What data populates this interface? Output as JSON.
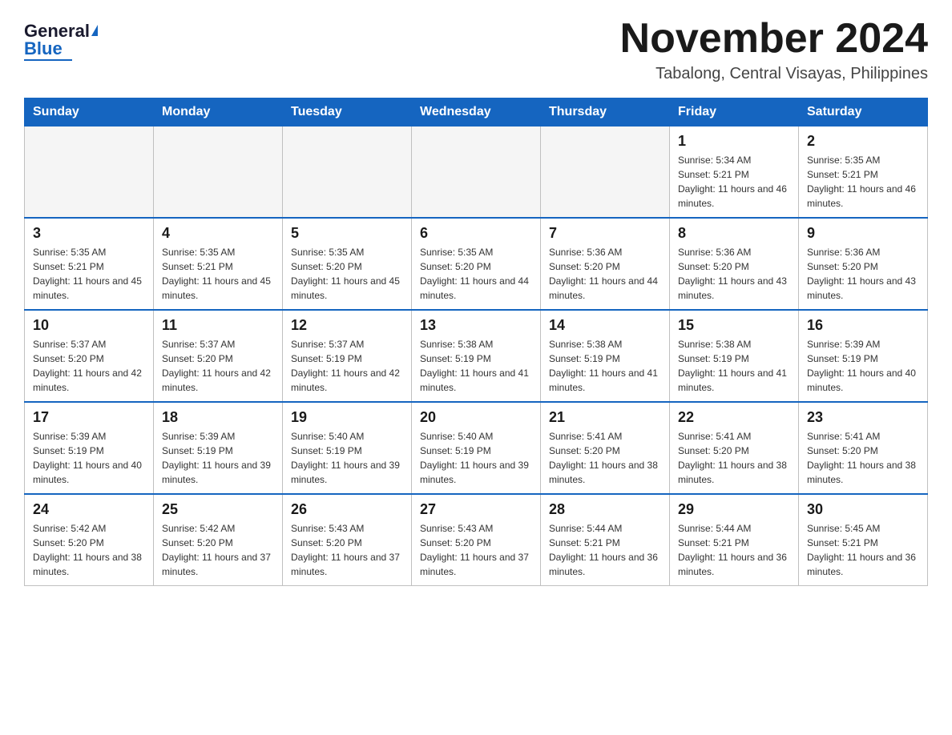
{
  "header": {
    "logo_general": "General",
    "logo_blue": "Blue",
    "month_title": "November 2024",
    "location": "Tabalong, Central Visayas, Philippines"
  },
  "weekdays": [
    "Sunday",
    "Monday",
    "Tuesday",
    "Wednesday",
    "Thursday",
    "Friday",
    "Saturday"
  ],
  "weeks": [
    [
      {
        "day": "",
        "sunrise": "",
        "sunset": "",
        "daylight": ""
      },
      {
        "day": "",
        "sunrise": "",
        "sunset": "",
        "daylight": ""
      },
      {
        "day": "",
        "sunrise": "",
        "sunset": "",
        "daylight": ""
      },
      {
        "day": "",
        "sunrise": "",
        "sunset": "",
        "daylight": ""
      },
      {
        "day": "",
        "sunrise": "",
        "sunset": "",
        "daylight": ""
      },
      {
        "day": "1",
        "sunrise": "Sunrise: 5:34 AM",
        "sunset": "Sunset: 5:21 PM",
        "daylight": "Daylight: 11 hours and 46 minutes."
      },
      {
        "day": "2",
        "sunrise": "Sunrise: 5:35 AM",
        "sunset": "Sunset: 5:21 PM",
        "daylight": "Daylight: 11 hours and 46 minutes."
      }
    ],
    [
      {
        "day": "3",
        "sunrise": "Sunrise: 5:35 AM",
        "sunset": "Sunset: 5:21 PM",
        "daylight": "Daylight: 11 hours and 45 minutes."
      },
      {
        "day": "4",
        "sunrise": "Sunrise: 5:35 AM",
        "sunset": "Sunset: 5:21 PM",
        "daylight": "Daylight: 11 hours and 45 minutes."
      },
      {
        "day": "5",
        "sunrise": "Sunrise: 5:35 AM",
        "sunset": "Sunset: 5:20 PM",
        "daylight": "Daylight: 11 hours and 45 minutes."
      },
      {
        "day": "6",
        "sunrise": "Sunrise: 5:35 AM",
        "sunset": "Sunset: 5:20 PM",
        "daylight": "Daylight: 11 hours and 44 minutes."
      },
      {
        "day": "7",
        "sunrise": "Sunrise: 5:36 AM",
        "sunset": "Sunset: 5:20 PM",
        "daylight": "Daylight: 11 hours and 44 minutes."
      },
      {
        "day": "8",
        "sunrise": "Sunrise: 5:36 AM",
        "sunset": "Sunset: 5:20 PM",
        "daylight": "Daylight: 11 hours and 43 minutes."
      },
      {
        "day": "9",
        "sunrise": "Sunrise: 5:36 AM",
        "sunset": "Sunset: 5:20 PM",
        "daylight": "Daylight: 11 hours and 43 minutes."
      }
    ],
    [
      {
        "day": "10",
        "sunrise": "Sunrise: 5:37 AM",
        "sunset": "Sunset: 5:20 PM",
        "daylight": "Daylight: 11 hours and 42 minutes."
      },
      {
        "day": "11",
        "sunrise": "Sunrise: 5:37 AM",
        "sunset": "Sunset: 5:20 PM",
        "daylight": "Daylight: 11 hours and 42 minutes."
      },
      {
        "day": "12",
        "sunrise": "Sunrise: 5:37 AM",
        "sunset": "Sunset: 5:19 PM",
        "daylight": "Daylight: 11 hours and 42 minutes."
      },
      {
        "day": "13",
        "sunrise": "Sunrise: 5:38 AM",
        "sunset": "Sunset: 5:19 PM",
        "daylight": "Daylight: 11 hours and 41 minutes."
      },
      {
        "day": "14",
        "sunrise": "Sunrise: 5:38 AM",
        "sunset": "Sunset: 5:19 PM",
        "daylight": "Daylight: 11 hours and 41 minutes."
      },
      {
        "day": "15",
        "sunrise": "Sunrise: 5:38 AM",
        "sunset": "Sunset: 5:19 PM",
        "daylight": "Daylight: 11 hours and 41 minutes."
      },
      {
        "day": "16",
        "sunrise": "Sunrise: 5:39 AM",
        "sunset": "Sunset: 5:19 PM",
        "daylight": "Daylight: 11 hours and 40 minutes."
      }
    ],
    [
      {
        "day": "17",
        "sunrise": "Sunrise: 5:39 AM",
        "sunset": "Sunset: 5:19 PM",
        "daylight": "Daylight: 11 hours and 40 minutes."
      },
      {
        "day": "18",
        "sunrise": "Sunrise: 5:39 AM",
        "sunset": "Sunset: 5:19 PM",
        "daylight": "Daylight: 11 hours and 39 minutes."
      },
      {
        "day": "19",
        "sunrise": "Sunrise: 5:40 AM",
        "sunset": "Sunset: 5:19 PM",
        "daylight": "Daylight: 11 hours and 39 minutes."
      },
      {
        "day": "20",
        "sunrise": "Sunrise: 5:40 AM",
        "sunset": "Sunset: 5:19 PM",
        "daylight": "Daylight: 11 hours and 39 minutes."
      },
      {
        "day": "21",
        "sunrise": "Sunrise: 5:41 AM",
        "sunset": "Sunset: 5:20 PM",
        "daylight": "Daylight: 11 hours and 38 minutes."
      },
      {
        "day": "22",
        "sunrise": "Sunrise: 5:41 AM",
        "sunset": "Sunset: 5:20 PM",
        "daylight": "Daylight: 11 hours and 38 minutes."
      },
      {
        "day": "23",
        "sunrise": "Sunrise: 5:41 AM",
        "sunset": "Sunset: 5:20 PM",
        "daylight": "Daylight: 11 hours and 38 minutes."
      }
    ],
    [
      {
        "day": "24",
        "sunrise": "Sunrise: 5:42 AM",
        "sunset": "Sunset: 5:20 PM",
        "daylight": "Daylight: 11 hours and 38 minutes."
      },
      {
        "day": "25",
        "sunrise": "Sunrise: 5:42 AM",
        "sunset": "Sunset: 5:20 PM",
        "daylight": "Daylight: 11 hours and 37 minutes."
      },
      {
        "day": "26",
        "sunrise": "Sunrise: 5:43 AM",
        "sunset": "Sunset: 5:20 PM",
        "daylight": "Daylight: 11 hours and 37 minutes."
      },
      {
        "day": "27",
        "sunrise": "Sunrise: 5:43 AM",
        "sunset": "Sunset: 5:20 PM",
        "daylight": "Daylight: 11 hours and 37 minutes."
      },
      {
        "day": "28",
        "sunrise": "Sunrise: 5:44 AM",
        "sunset": "Sunset: 5:21 PM",
        "daylight": "Daylight: 11 hours and 36 minutes."
      },
      {
        "day": "29",
        "sunrise": "Sunrise: 5:44 AM",
        "sunset": "Sunset: 5:21 PM",
        "daylight": "Daylight: 11 hours and 36 minutes."
      },
      {
        "day": "30",
        "sunrise": "Sunrise: 5:45 AM",
        "sunset": "Sunset: 5:21 PM",
        "daylight": "Daylight: 11 hours and 36 minutes."
      }
    ]
  ]
}
